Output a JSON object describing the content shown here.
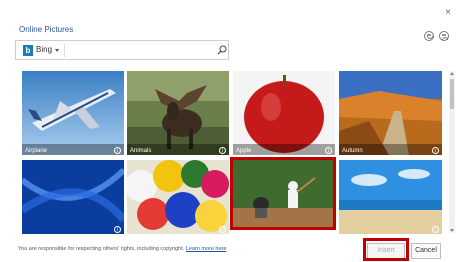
{
  "dialog": {
    "title": "Online Pictures",
    "close_glyph": "×"
  },
  "search": {
    "source_label": "Bing",
    "source_logo_letter": "b",
    "placeholder": "",
    "value": ""
  },
  "tiles": [
    {
      "caption": "Airplane",
      "icon": "airplane-photo"
    },
    {
      "caption": "Animals",
      "icon": "moose-photo"
    },
    {
      "caption": "Apple",
      "icon": "apple-photo"
    },
    {
      "caption": "Autumn",
      "icon": "autumn-path-photo"
    },
    {
      "caption": "",
      "icon": "blue-abstract-photo"
    },
    {
      "caption": "",
      "icon": "balloons-photo"
    },
    {
      "caption": "",
      "icon": "baseball-photo",
      "selected": true
    },
    {
      "caption": "",
      "icon": "beach-photo"
    }
  ],
  "footer": {
    "notice": "You are responsible for respecting others' rights, including copyright.",
    "learn_more": "Learn more here"
  },
  "buttons": {
    "insert": "Insert",
    "cancel": "Cancel"
  },
  "colors": {
    "title": "#2b5797",
    "highlight": "#c00000",
    "bing": "#1c7bb8"
  }
}
